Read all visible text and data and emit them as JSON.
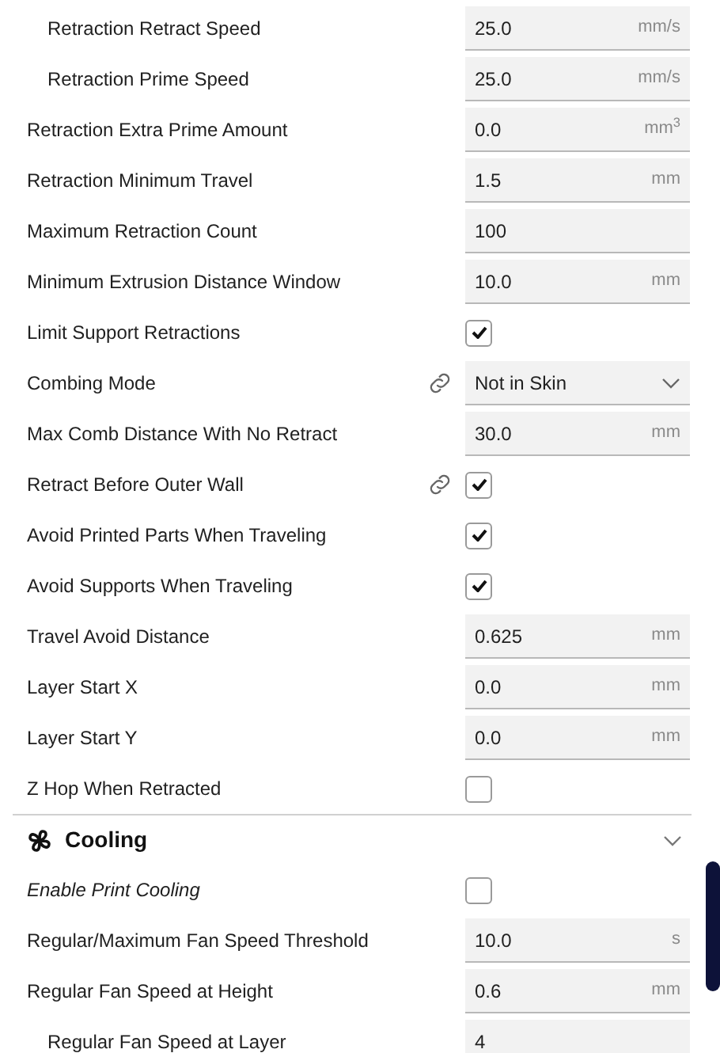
{
  "settings": [
    {
      "label": "Retraction Retract Speed",
      "indented": true,
      "linked": false,
      "kind": "number",
      "value": "25.0",
      "unit": "mm/s"
    },
    {
      "label": "Retraction Prime Speed",
      "indented": true,
      "linked": false,
      "kind": "number",
      "value": "25.0",
      "unit": "mm/s"
    },
    {
      "label": "Retraction Extra Prime Amount",
      "indented": false,
      "linked": false,
      "kind": "number",
      "value": "0.0",
      "unit": "mm$^{3}$"
    },
    {
      "label": "Retraction Minimum Travel",
      "indented": false,
      "linked": false,
      "kind": "number",
      "value": "1.5",
      "unit": "mm"
    },
    {
      "label": "Maximum Retraction Count",
      "indented": false,
      "linked": false,
      "kind": "number",
      "value": "100"
    },
    {
      "label": "Minimum Extrusion Distance Window",
      "indented": false,
      "linked": false,
      "kind": "number",
      "value": "10.0",
      "unit": "mm"
    },
    {
      "label": "Limit Support Retractions",
      "indented": false,
      "linked": false,
      "kind": "checkbox",
      "checked": true
    },
    {
      "label": "Combing Mode",
      "indented": false,
      "linked": true,
      "kind": "dropdown",
      "value": "Not in Skin"
    },
    {
      "label": "Max Comb Distance With No Retract",
      "indented": false,
      "linked": false,
      "kind": "number",
      "value": "30.0",
      "unit": "mm"
    },
    {
      "label": "Retract Before Outer Wall",
      "indented": false,
      "linked": true,
      "kind": "checkbox",
      "checked": true
    },
    {
      "label": "Avoid Printed Parts When Traveling",
      "indented": false,
      "linked": false,
      "kind": "checkbox",
      "checked": true
    },
    {
      "label": "Avoid Supports When Traveling",
      "indented": false,
      "linked": false,
      "kind": "checkbox",
      "checked": true
    },
    {
      "label": "Travel Avoid Distance",
      "indented": false,
      "linked": false,
      "kind": "number",
      "value": "0.625",
      "unit": "mm"
    },
    {
      "label": "Layer Start X",
      "indented": false,
      "linked": false,
      "kind": "number",
      "value": "0.0",
      "unit": "mm"
    },
    {
      "label": "Layer Start Y",
      "indented": false,
      "linked": false,
      "kind": "number",
      "value": "0.0",
      "unit": "mm"
    },
    {
      "label": "Z Hop When Retracted",
      "indented": false,
      "linked": false,
      "kind": "checkbox",
      "checked": false
    }
  ],
  "cooling": {
    "title": "Cooling",
    "expanded": true,
    "settings": [
      {
        "label": "Enable Print Cooling",
        "indented": false,
        "linked": false,
        "italic": true,
        "kind": "checkbox",
        "checked": false
      },
      {
        "label": "Regular/Maximum Fan Speed Threshold",
        "indented": false,
        "linked": false,
        "kind": "number",
        "value": "10.0",
        "unit": "s"
      },
      {
        "label": "Regular Fan Speed at Height",
        "indented": false,
        "linked": false,
        "kind": "number",
        "value": "0.6",
        "unit": "mm"
      },
      {
        "label": "Regular Fan Speed at Layer",
        "indented": true,
        "linked": false,
        "kind": "number",
        "value": "4"
      }
    ]
  }
}
